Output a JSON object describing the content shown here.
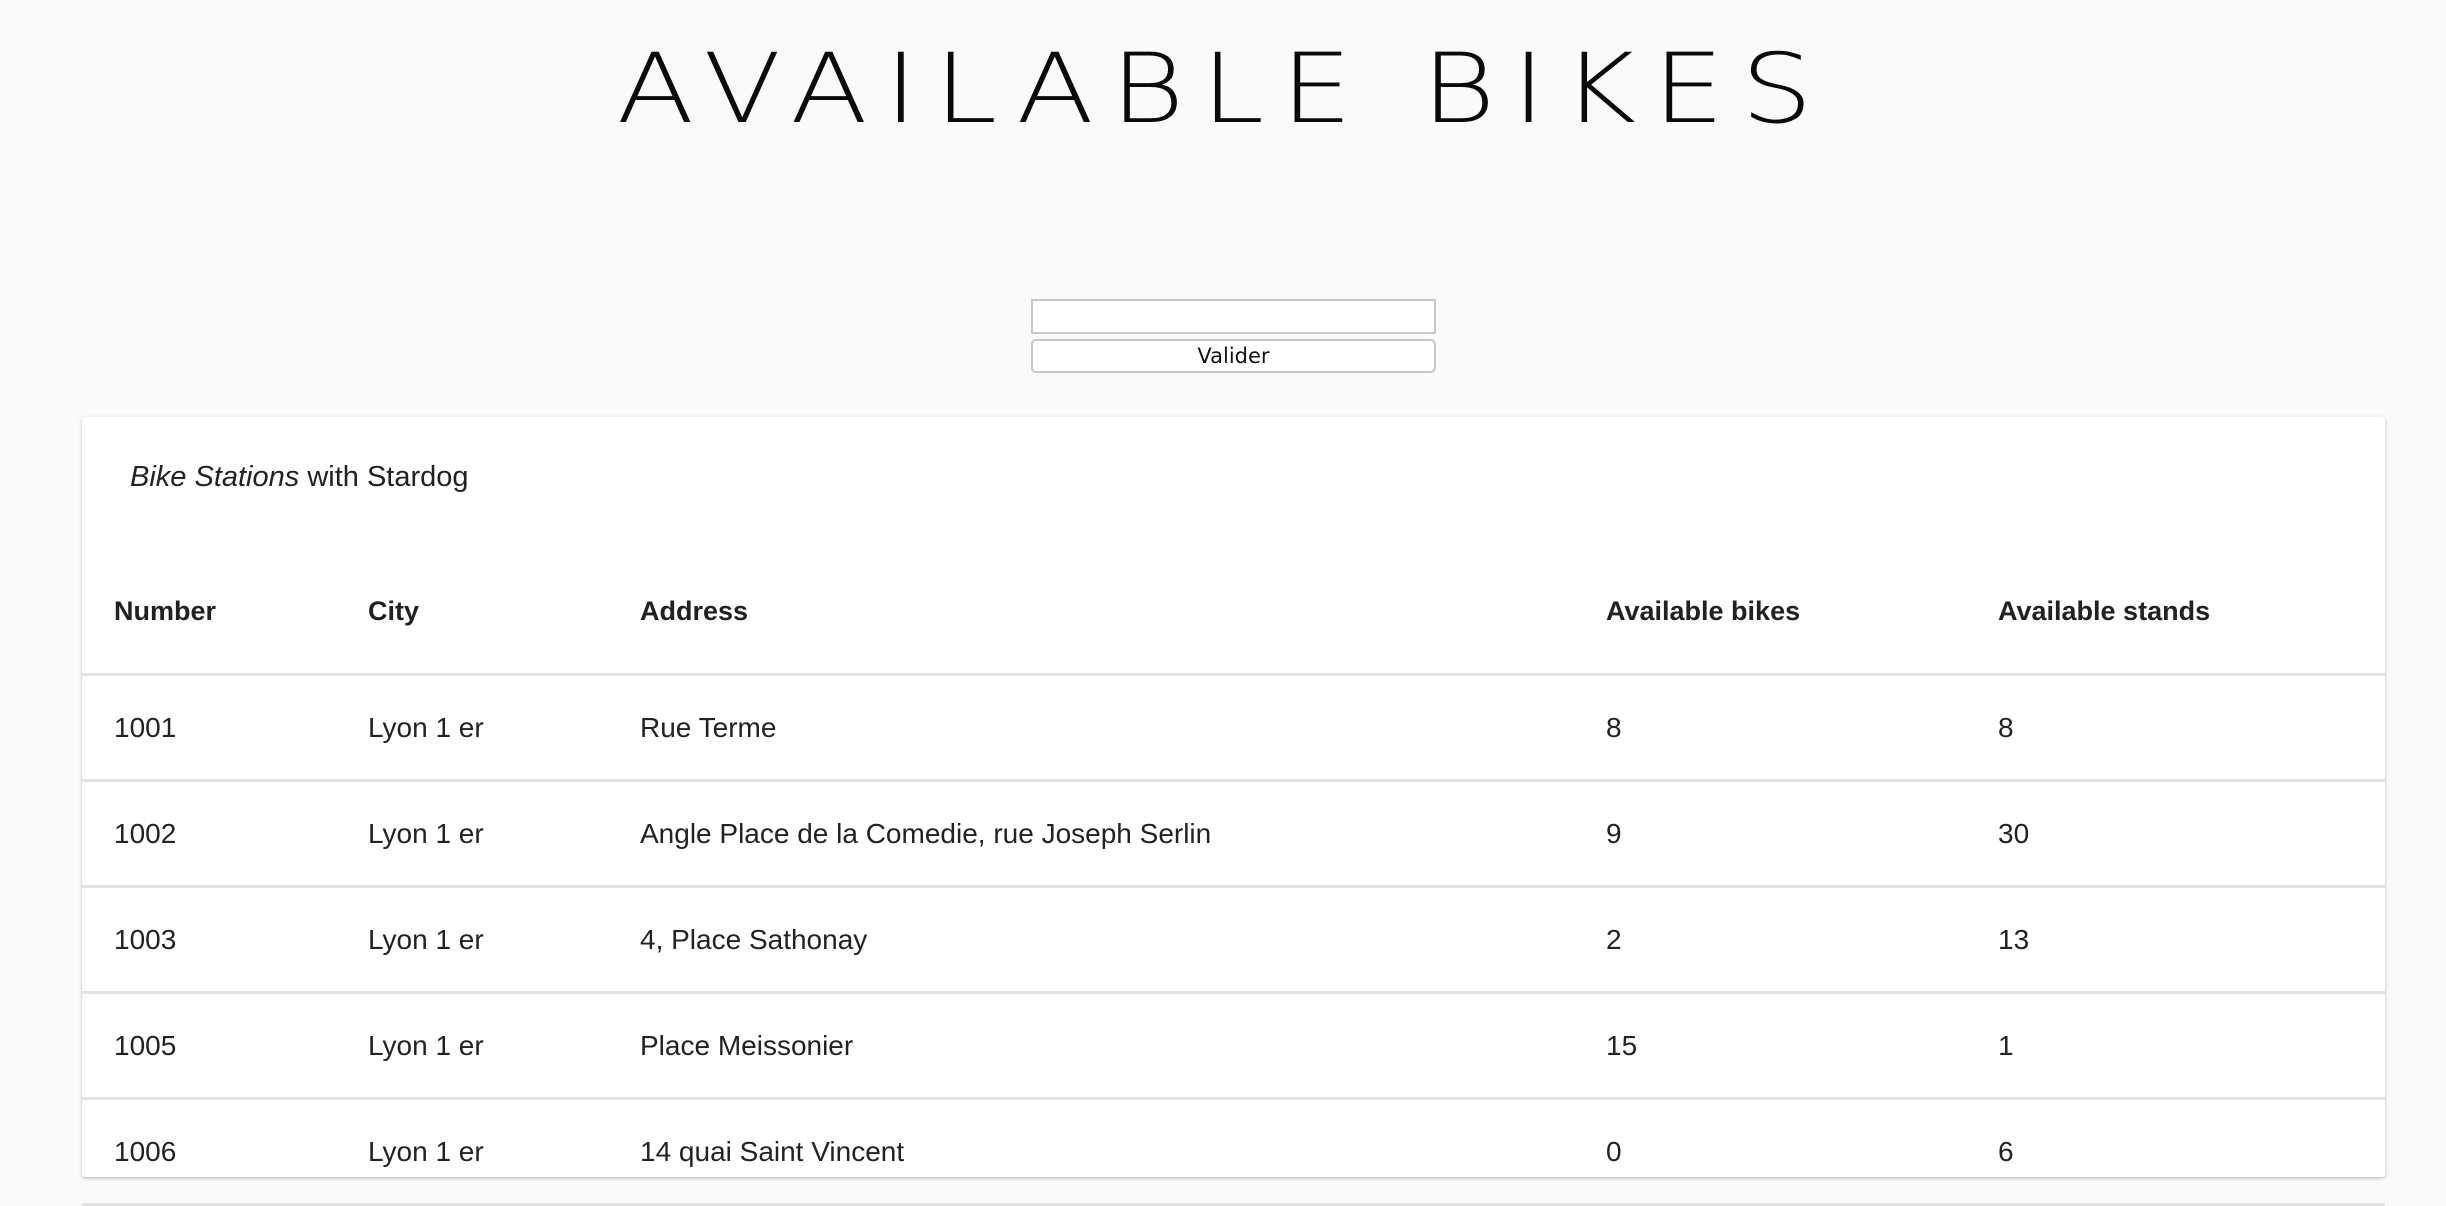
{
  "header": {
    "title": "AVAILABLE BIKES"
  },
  "search": {
    "value": "",
    "placeholder": "",
    "submit_label": "Valider"
  },
  "card": {
    "title_italic": "Bike Stations",
    "title_rest": " with Stardog"
  },
  "table": {
    "headers": {
      "number": "Number",
      "city": "City",
      "address": "Address",
      "bikes": "Available bikes",
      "stands": "Available stands"
    },
    "rows": [
      {
        "number": "1001",
        "city": "Lyon 1 er",
        "address": "Rue Terme",
        "bikes": "8",
        "stands": "8"
      },
      {
        "number": "1002",
        "city": "Lyon 1 er",
        "address": "Angle Place de la Comedie, rue Joseph Serlin",
        "bikes": "9",
        "stands": "30"
      },
      {
        "number": "1003",
        "city": "Lyon 1 er",
        "address": "4, Place Sathonay",
        "bikes": "2",
        "stands": "13"
      },
      {
        "number": "1005",
        "city": "Lyon 1 er",
        "address": "Place Meissonier",
        "bikes": "15",
        "stands": "1"
      },
      {
        "number": "1006",
        "city": "Lyon 1 er",
        "address": "14 quai Saint Vincent",
        "bikes": "0",
        "stands": "6"
      }
    ]
  }
}
